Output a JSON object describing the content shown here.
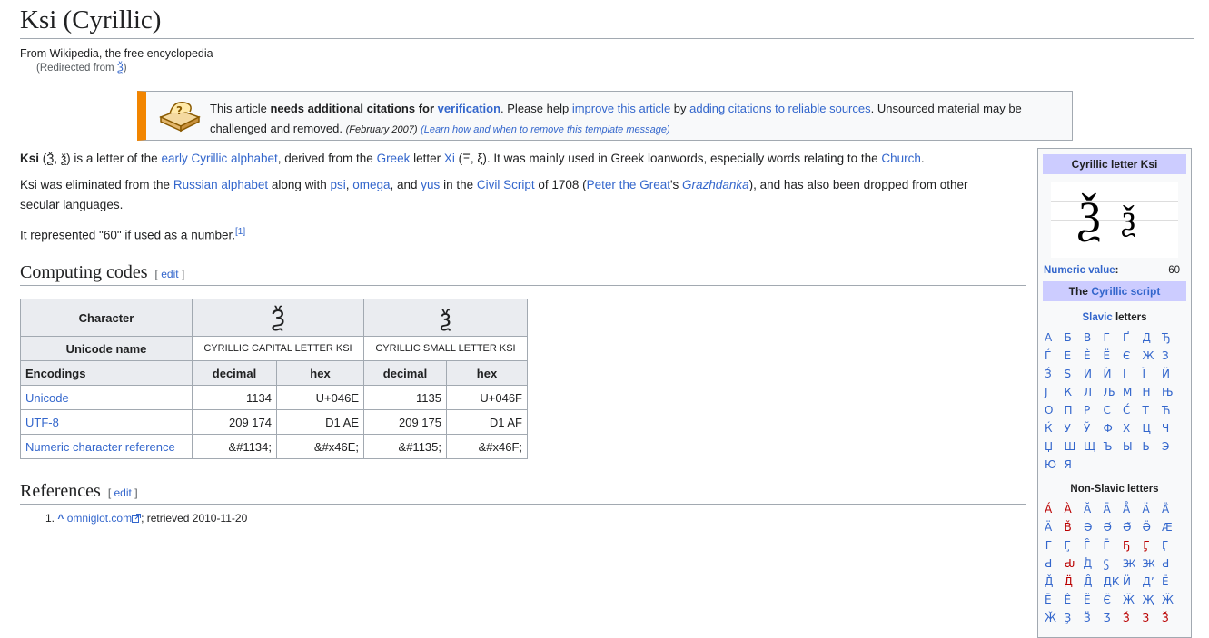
{
  "page_title": "Ksi (Cyrillic)",
  "tagline": "From Wikipedia, the free encyclopedia",
  "redirect_prefix": "(Redirected from ",
  "redirect_link": "Ѯ",
  "redirect_suffix": ")",
  "ambox": {
    "t1": "This article ",
    "t2": "needs additional citations for ",
    "t3": "verification",
    "t4": ". Please help ",
    "t5": "improve this article",
    "t6": " by ",
    "t7": "adding citations to reliable sources",
    "t8": ". Unsourced material may be challenged and removed.",
    "date": "(February 2007)",
    "learn": "(Learn how and when to remove this template message)"
  },
  "p1": {
    "bold": "Ksi",
    "open": " (",
    "cap": "Ѯ",
    "sep": ", ",
    "small": "ѯ",
    "t1": ") is a letter of the ",
    "l1": "early Cyrillic alphabet",
    "t2": ", derived from the ",
    "l2": "Greek",
    "t3": " letter ",
    "l3": "Xi",
    "t4": " (Ξ, ξ). It was mainly used in Greek loanwords, especially words relating to the ",
    "l4": "Church",
    "t5": "."
  },
  "p2": {
    "t1": "Ksi was eliminated from the ",
    "l1": "Russian alphabet",
    "t2": " along with ",
    "l2": "psi",
    "t3": ", ",
    "l3": "omega",
    "t4": ", and ",
    "l4": "yus",
    "t5": " in the ",
    "l5": "Civil Script",
    "t6": " of 1708 (",
    "l6": "Peter the Great",
    "t7": "'s ",
    "l7": "Grazhdanka",
    "t8": "), and has also been dropped from other",
    "t9": "secular languages."
  },
  "p3": {
    "text": "It represented \"60\" if used as a number.",
    "ref": "[1]"
  },
  "sections": {
    "computing": "Computing codes",
    "references": "References",
    "edit": "edit",
    "lb": "[ ",
    "rb": " ]"
  },
  "codes_table": {
    "character_label": "Character",
    "cap_glyph": "Ѯ",
    "small_glyph": "ѯ",
    "unicode_name_label": "Unicode name",
    "cap_name": "Cyrillic capital letter ksi",
    "small_name": "Cyrillic small letter ksi",
    "encodings_label": "Encodings",
    "decimal": "decimal",
    "hex": "hex",
    "rows": [
      {
        "name": "Unicode",
        "v1": "1134",
        "v2": "U+046E",
        "v3": "1135",
        "v4": "U+046F"
      },
      {
        "name": "UTF-8",
        "v1": "209 174",
        "v2": "D1 AE",
        "v3": "209 175",
        "v4": "D1 AF"
      },
      {
        "name": "Numeric character reference",
        "v1": "&#1134;",
        "v2": "&#x46E;",
        "v3": "&#1135;",
        "v4": "&#x46F;"
      }
    ]
  },
  "reference_item": {
    "num": "1.",
    "caret": "^",
    "link": "omniglot.com",
    "ext_icon": "external-link-icon",
    "rest": "; retrieved 2010-11-20"
  },
  "infobox": {
    "title": "Cyrillic letter Ksi",
    "img_cap": "Ѯ",
    "img_small": "ѯ",
    "numeric_label": "Numeric value",
    "colon": ":",
    "numeric_value": "60",
    "script_pre": "The ",
    "script_link": "Cyrillic script",
    "slavic_link": "Slavic",
    "slavic_rest": " letters",
    "slavic": [
      "А",
      "Б",
      "В",
      "Г",
      "Ґ",
      "Д",
      "Ђ",
      "Ѓ",
      "Е",
      "Ѐ",
      "Ё",
      "Є",
      "Ж",
      "З",
      "З́",
      "Ѕ",
      "И",
      "Ѝ",
      "І",
      "Ї",
      "Й",
      "Ј",
      "К",
      "Л",
      "Љ",
      "М",
      "Н",
      "Њ",
      "О",
      "П",
      "Р",
      "С",
      "С́",
      "Т",
      "Ћ",
      "Ќ",
      "У",
      "Ў",
      "Ф",
      "Х",
      "Ц",
      "Ч",
      "Џ",
      "Ш",
      "Щ",
      "Ъ",
      "Ы",
      "Ь",
      "Э",
      "Ю",
      "Я"
    ],
    "nonslavic_title": "Non-Slavic letters",
    "nonslavic": [
      {
        "c": "А́",
        "r": true
      },
      {
        "c": "А̀",
        "r": true
      },
      {
        "c": "Ӑ",
        "r": false
      },
      {
        "c": "А̄",
        "r": false
      },
      {
        "c": "А̊",
        "r": false
      },
      {
        "c": "Ӓ",
        "r": false
      },
      {
        "c": "Ӓ̄",
        "r": false
      },
      {
        "c": "Ӓ",
        "r": false
      },
      {
        "c": "В̌",
        "r": true
      },
      {
        "c": "Ә",
        "r": false
      },
      {
        "c": "Ә́",
        "r": false
      },
      {
        "c": "Ә̃",
        "r": false
      },
      {
        "c": "Ӛ",
        "r": false
      },
      {
        "c": "Ӕ",
        "r": false
      },
      {
        "c": "Ғ",
        "r": false
      },
      {
        "c": "Г̧",
        "r": false
      },
      {
        "c": "Г̑",
        "r": false
      },
      {
        "c": "Г̄",
        "r": false
      },
      {
        "c": "Ҕ",
        "r": true
      },
      {
        "c": "Ӻ",
        "r": true
      },
      {
        "c": "Ӷ",
        "r": false
      },
      {
        "c": "Ԁ",
        "r": false
      },
      {
        "c": "Ԃ",
        "r": true
      },
      {
        "c": "Ꚁ",
        "r": false
      },
      {
        "c": "Ꚃ",
        "r": false
      },
      {
        "c": "Ꚅ",
        "r": false
      },
      {
        "c": "Ꚅ",
        "r": false
      },
      {
        "c": "Ԁ",
        "r": false
      },
      {
        "c": "Д̌",
        "r": false
      },
      {
        "c": "Д̈",
        "r": true
      },
      {
        "c": "Д̑",
        "r": false
      },
      {
        "c": "ДК",
        "r": false
      },
      {
        "c": "Ӥ",
        "r": false
      },
      {
        "c": "Дʼ",
        "r": false
      },
      {
        "c": "Ё",
        "r": false
      },
      {
        "c": "Е̄",
        "r": false
      },
      {
        "c": "Е̂",
        "r": false
      },
      {
        "c": "Е̃",
        "r": false
      },
      {
        "c": "Є̈",
        "r": false
      },
      {
        "c": "Ӂ",
        "r": false
      },
      {
        "c": "Җ",
        "r": false
      },
      {
        "c": "Ӝ",
        "r": false
      },
      {
        "c": "Ӂ",
        "r": false
      },
      {
        "c": "Ҙ",
        "r": false
      },
      {
        "c": "Ӟ",
        "r": false
      },
      {
        "c": "Ӡ",
        "r": false
      },
      {
        "c": "З̌",
        "r": true
      },
      {
        "c": "З̱",
        "r": true
      },
      {
        "c": "З̆",
        "r": true
      }
    ]
  }
}
